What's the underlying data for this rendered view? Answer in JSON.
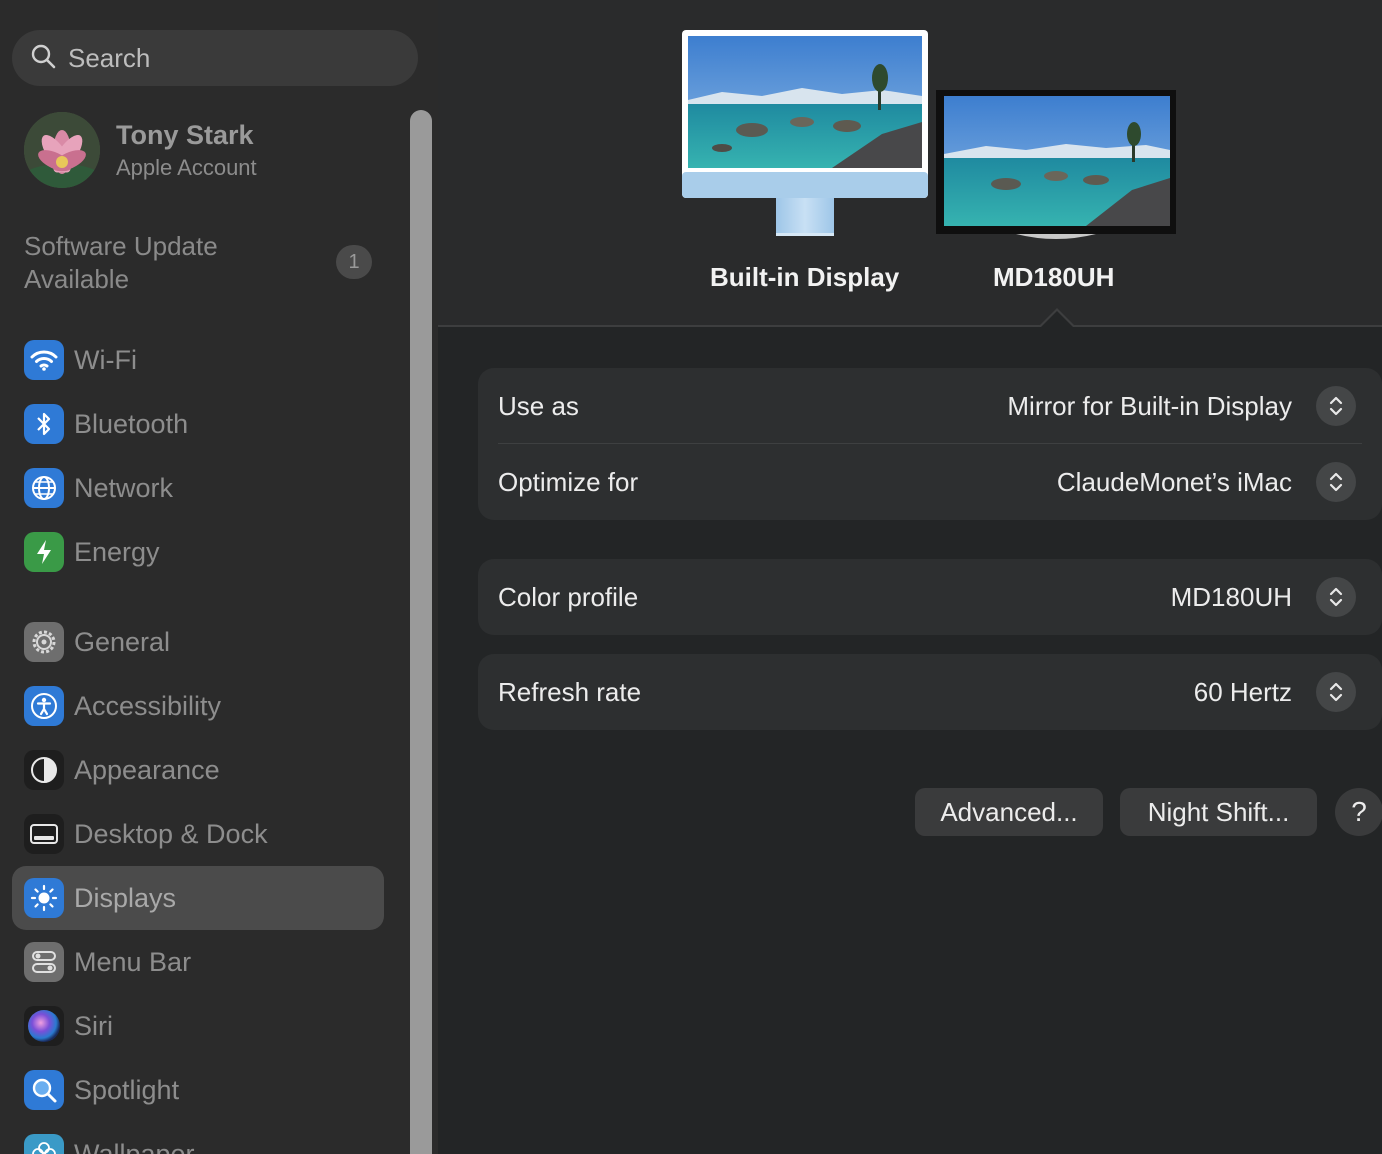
{
  "sidebar": {
    "search_placeholder": "Search",
    "account": {
      "name": "Tony Stark",
      "subtitle": "Apple Account"
    },
    "software_update": {
      "label": "Software Update Available",
      "badge": "1"
    },
    "items": [
      {
        "label": "Wi-Fi",
        "icon": "wifi-icon",
        "color": "#2f7ad6"
      },
      {
        "label": "Bluetooth",
        "icon": "bluetooth-icon",
        "color": "#2f7ad6"
      },
      {
        "label": "Network",
        "icon": "globe-icon",
        "color": "#2f7ad6"
      },
      {
        "label": "Energy",
        "icon": "bolt-icon",
        "color": "#3a9a47"
      },
      {
        "label": "General",
        "icon": "gear-icon",
        "color": "#7a7a7a"
      },
      {
        "label": "Accessibility",
        "icon": "accessibility-icon",
        "color": "#2f7ad6"
      },
      {
        "label": "Appearance",
        "icon": "appearance-icon",
        "color": "#1e1e1e"
      },
      {
        "label": "Desktop & Dock",
        "icon": "dock-icon",
        "color": "#1e1e1e"
      },
      {
        "label": "Displays",
        "icon": "sun-icon",
        "color": "#2f7ad6",
        "selected": true
      },
      {
        "label": "Menu Bar",
        "icon": "toggles-icon",
        "color": "#7a7a7a"
      },
      {
        "label": "Siri",
        "icon": "siri-icon",
        "color": "#6a3fb8"
      },
      {
        "label": "Spotlight",
        "icon": "magnifier-icon",
        "color": "#2f7ad6"
      },
      {
        "label": "Wallpaper",
        "icon": "flower-icon",
        "color": "#3a9ac7"
      }
    ]
  },
  "displays": {
    "builtin_label": "Built-in Display",
    "external_label": "MD180UH"
  },
  "settings": {
    "use_as": {
      "label": "Use as",
      "value": "Mirror for Built-in Display"
    },
    "optimize_for": {
      "label": "Optimize for",
      "value": "ClaudeMonet’s iMac"
    },
    "color_profile": {
      "label": "Color profile",
      "value": "MD180UH"
    },
    "refresh_rate": {
      "label": "Refresh rate",
      "value": "60 Hertz"
    }
  },
  "buttons": {
    "advanced": "Advanced...",
    "night_shift": "Night Shift...",
    "help": "?"
  }
}
